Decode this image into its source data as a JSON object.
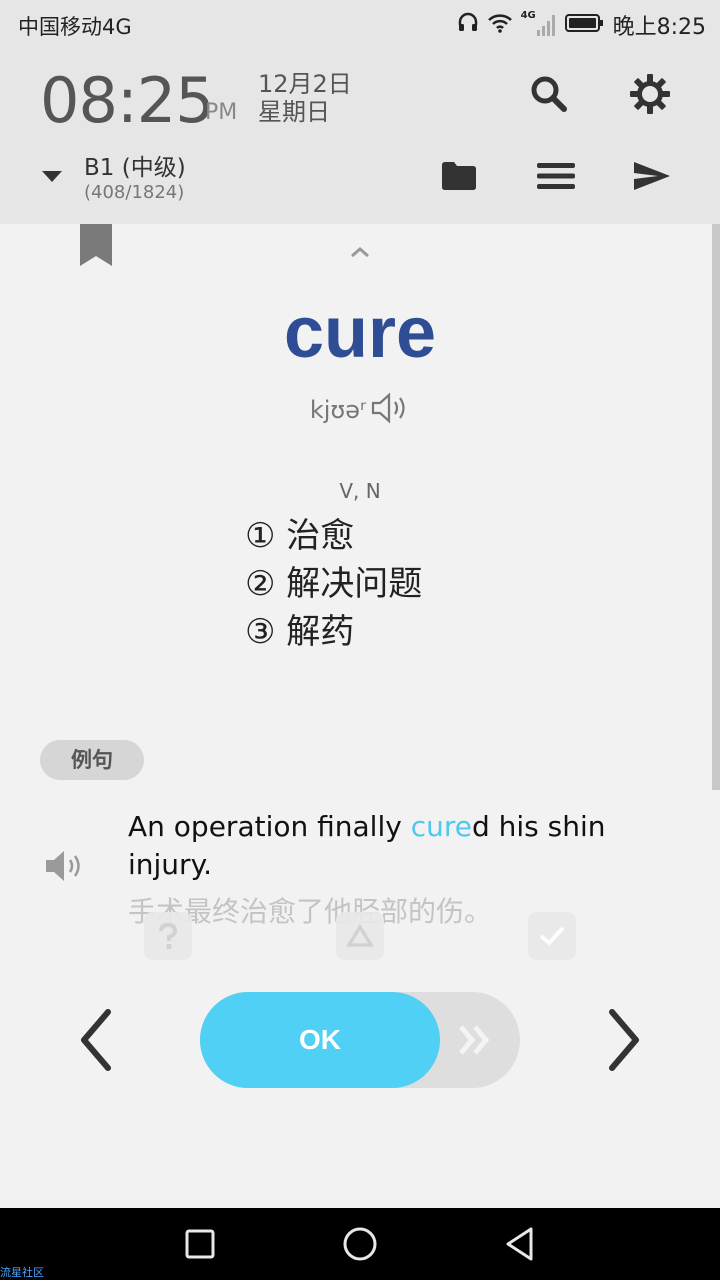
{
  "status_bar": {
    "carrier": "中国移动4G",
    "network_badge": "4G",
    "time": "晚上8:25",
    "icons": [
      "headset-icon",
      "wifi-icon",
      "signal-icon",
      "battery-icon"
    ]
  },
  "header": {
    "clock": "08:25",
    "ampm": "PM",
    "date_line1": "12月2日",
    "date_line2": "星期日",
    "level_title": "B1 (中级)",
    "level_progress": "(408/1824)",
    "icons": [
      "search-icon",
      "gear-icon",
      "folder-icon",
      "menu-icon",
      "send-icon",
      "caret-down-icon"
    ]
  },
  "card": {
    "word": "cure",
    "phonetic": "kjʊəʳ",
    "pos": "V, N",
    "definitions": [
      "① 治愈",
      "② 解决问题",
      "③ 解药"
    ],
    "example_badge": "例句",
    "example_en_before": "An operation finally ",
    "example_en_highlight": "cure",
    "example_en_after": "d his shin injury.",
    "example_cn": "手术最终治愈了他胫部的伤。"
  },
  "controls": {
    "ok_label": "OK",
    "icons": [
      "question-icon",
      "triangle-icon",
      "check-icon",
      "chevron-left-icon",
      "chevron-right-icon",
      "double-chevron-right-icon"
    ]
  },
  "navbar": {
    "icons": [
      "recent-apps-icon",
      "home-icon",
      "back-icon"
    ]
  },
  "watermark": "流星社区",
  "colors": {
    "word": "#2e4d94",
    "highlight": "#4ec8ee",
    "ok_button": "#4fd0f4"
  }
}
